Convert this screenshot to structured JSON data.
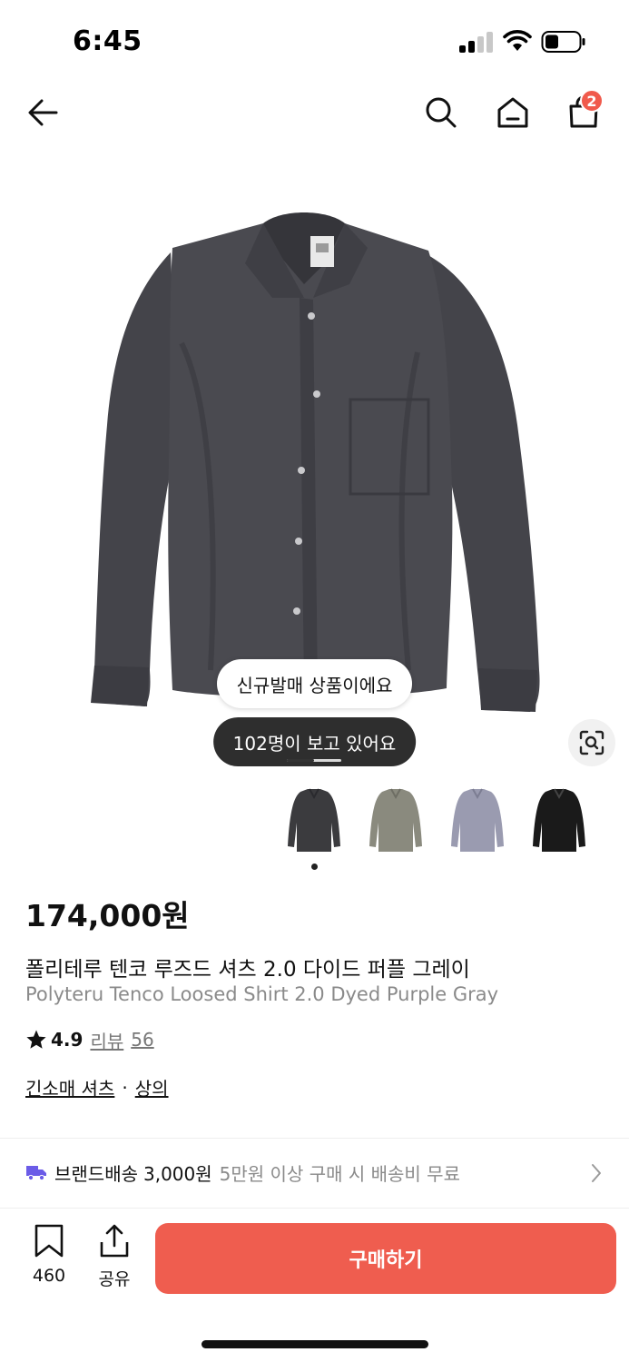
{
  "status_bar": {
    "time": "6:45",
    "signal_icon": "cellular-signal-icon",
    "wifi_icon": "wifi-icon",
    "battery_icon": "battery-icon"
  },
  "nav": {
    "back_icon": "arrow-left-icon",
    "search_icon": "search-icon",
    "home_icon": "home-icon",
    "cart_icon": "shopping-bag-icon",
    "cart_count": "2"
  },
  "hero": {
    "badge_new": "신규발매 상품이에요",
    "viewers": "102명이 보고 있어요",
    "lens_icon": "image-search-icon",
    "thumbnails": [
      {
        "color_name": "dark-gray",
        "color": "#3b3b3e"
      },
      {
        "color_name": "olive-gray",
        "color": "#8a8a7e"
      },
      {
        "color_name": "light-blue-gray",
        "color": "#9a9bb0"
      },
      {
        "color_name": "black",
        "color": "#1a1a1a"
      }
    ]
  },
  "product": {
    "price": "174,000원",
    "title_ko": "폴리테루 텐코 루즈드 셔츠 2.0 다이드 퍼플 그레이",
    "title_en": "Polyteru Tenco Loosed Shirt 2.0 Dyed Purple Gray",
    "rating": "4.9",
    "review_label": "리뷰",
    "review_count": "56",
    "category_1": "긴소매 셔츠",
    "category_separator": "·",
    "category_2": "상의"
  },
  "shipping": {
    "truck_icon": "delivery-truck-icon",
    "brand_label": "브랜드배송",
    "fee": "3,000원",
    "note": "5만원 이상 구매 시 배송비 무료"
  },
  "bottom_bar": {
    "bookmark_count": "460",
    "share_label": "공유",
    "buy_label": "구매하기"
  },
  "colors": {
    "accent": "#ef5d4f",
    "badge": "#f05a4c",
    "truck": "#6b5ce7"
  }
}
